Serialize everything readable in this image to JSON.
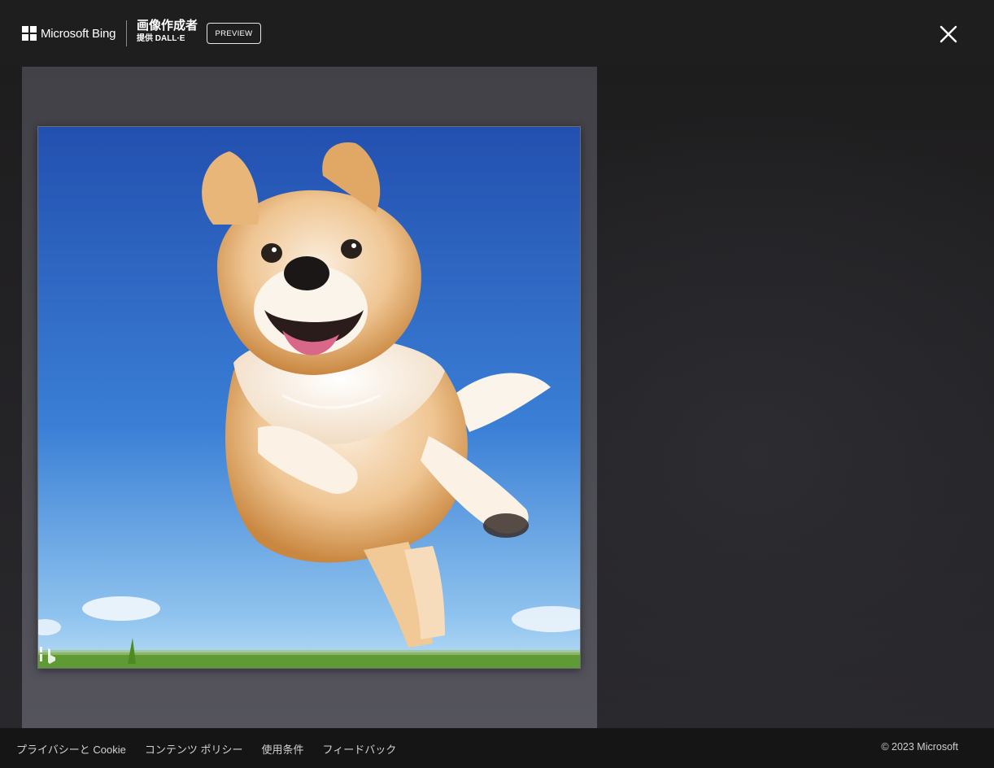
{
  "header": {
    "brand_name": "Microsoft Bing",
    "product_title": "画像作成者",
    "product_subtitle": "提供 DALL·E",
    "preview_badge": "PREVIEW",
    "close_icon": "close-icon"
  },
  "viewer": {
    "image_subject": "dog-image",
    "watermark_icon": "bing-watermark-icon"
  },
  "footer": {
    "links": [
      "プライバシーと Cookie",
      "コンテンツ ポリシー",
      "使用条件",
      "フィードバック"
    ],
    "copyright": "© 2023 Microsoft"
  },
  "colors": {
    "background": "#1b1b1c",
    "footer": "#151515",
    "sky": "#2f67c4"
  }
}
